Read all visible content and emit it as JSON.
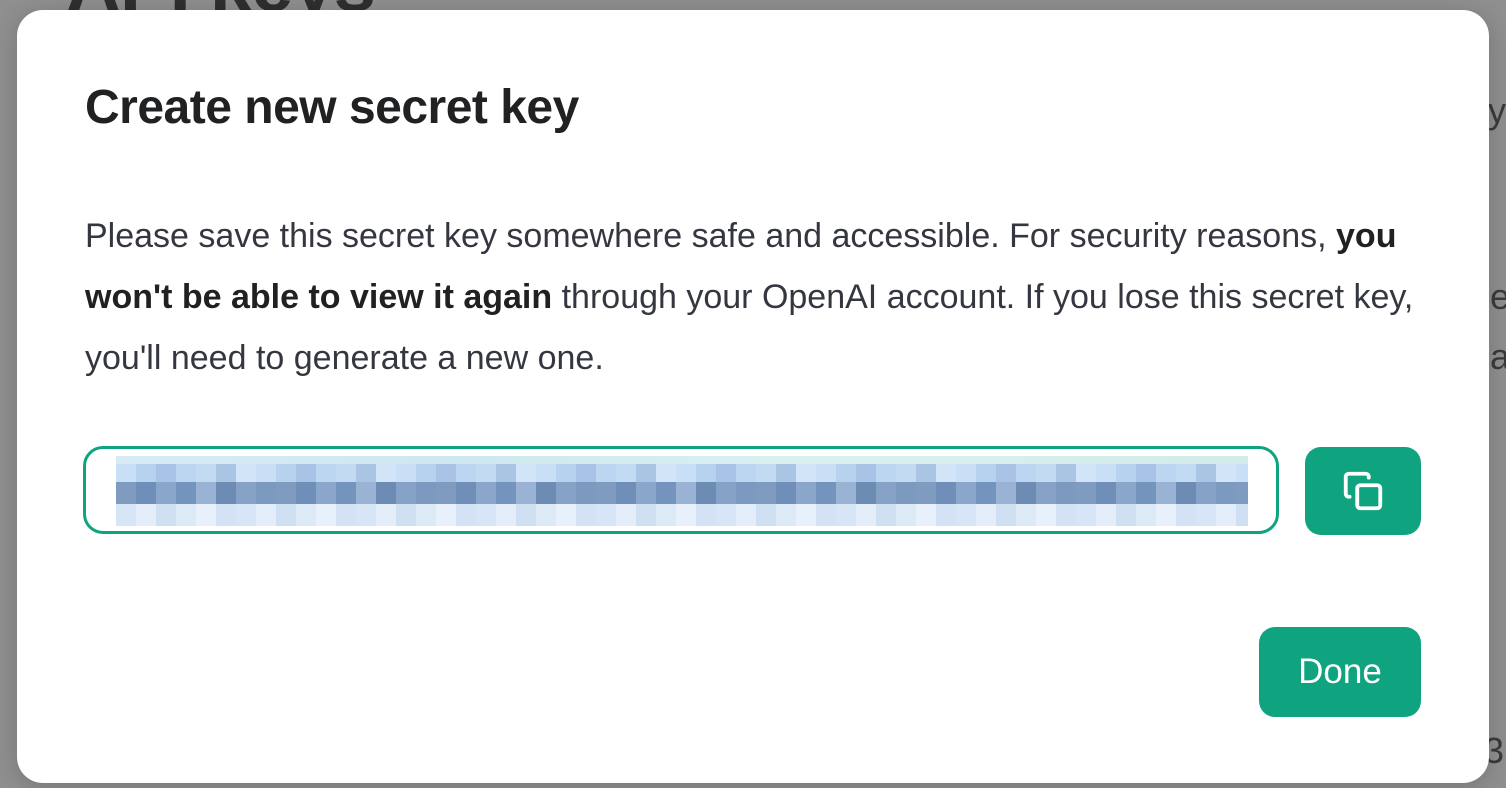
{
  "background": {
    "heading": "API keys",
    "fragments": [
      "y",
      "e",
      "a",
      "3"
    ]
  },
  "modal": {
    "title": "Create new secret key",
    "description": {
      "part1": "Please save this secret key somewhere safe and accessible. For security reasons, ",
      "bold": "you won't be able to view it again",
      "part2": " through your OpenAI account. If you lose this secret key, you'll need to generate a new one."
    },
    "key_field": {
      "value_state": "pixelated / redacted"
    },
    "copy_button": {
      "icon": "copy-icon"
    },
    "done_label": "Done"
  },
  "colors": {
    "accent": "#10a37f",
    "overlay": "#8f8f8f",
    "title_text": "#202123",
    "body_text": "#353740"
  }
}
